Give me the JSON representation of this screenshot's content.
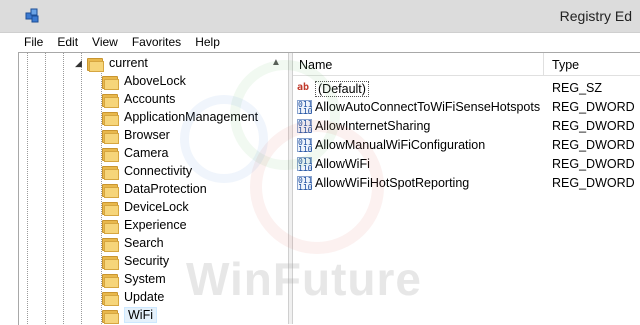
{
  "window": {
    "title": "Registry Ed"
  },
  "menu": [
    "File",
    "Edit",
    "View",
    "Favorites",
    "Help"
  ],
  "tree": {
    "parent": "current",
    "children": [
      "AboveLock",
      "Accounts",
      "ApplicationManagement",
      "Browser",
      "Camera",
      "Connectivity",
      "DataProtection",
      "DeviceLock",
      "Experience",
      "Search",
      "Security",
      "System",
      "Update",
      "WiFi"
    ],
    "selected": "WiFi"
  },
  "list": {
    "columns": {
      "name": "Name",
      "type": "Type"
    },
    "rows": [
      {
        "icon": "string-value-icon",
        "name": "(Default)",
        "type": "REG_SZ"
      },
      {
        "icon": "dword-value-icon",
        "name": "AllowAutoConnectToWiFiSenseHotspots",
        "type": "REG_DWORD"
      },
      {
        "icon": "dword-value-icon",
        "name": "AllowInternetSharing",
        "type": "REG_DWORD"
      },
      {
        "icon": "dword-value-icon",
        "name": "AllowManualWiFiConfiguration",
        "type": "REG_DWORD"
      },
      {
        "icon": "dword-value-icon",
        "name": "AllowWiFi",
        "type": "REG_DWORD"
      },
      {
        "icon": "dword-value-icon",
        "name": "AllowWiFiHotSpotReporting",
        "type": "REG_DWORD"
      }
    ]
  },
  "watermark": "WinFuture",
  "colors": {
    "folder": "#f6d57a",
    "selection": "#e5f1fb",
    "titlebar": "#dcdcdc"
  }
}
